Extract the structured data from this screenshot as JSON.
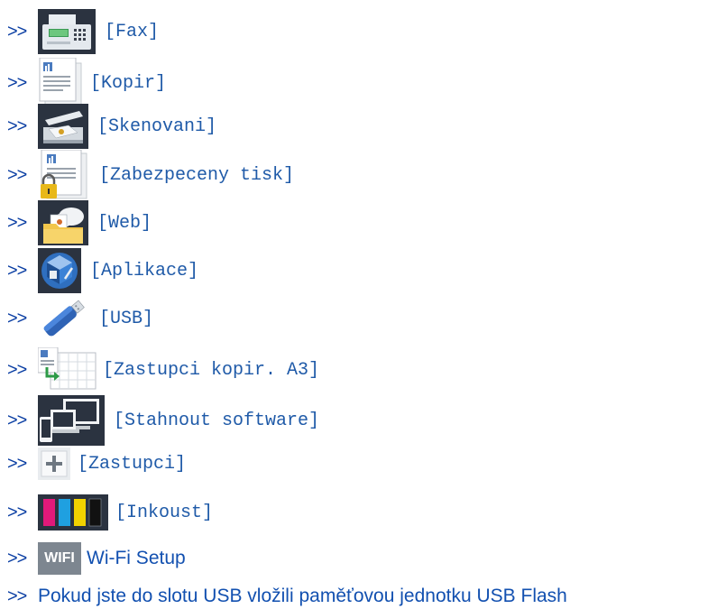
{
  "links": [
    {
      "arrow": ">>",
      "label": "[Fax]",
      "icon": "fax-icon"
    },
    {
      "arrow": ">>",
      "label": "[Kopir]",
      "icon": "copy-icon"
    },
    {
      "arrow": ">>",
      "label": "[Skenovani]",
      "icon": "scanner-icon"
    },
    {
      "arrow": ">>",
      "label": "[Zabezpeceny tisk]",
      "icon": "secure-print-icon"
    },
    {
      "arrow": ">>",
      "label": "[Web]",
      "icon": "web-folder-icon"
    },
    {
      "arrow": ">>",
      "label": "[Aplikace]",
      "icon": "apps-icon"
    },
    {
      "arrow": ">>",
      "label": "[USB]",
      "icon": "usb-icon"
    },
    {
      "arrow": ">>",
      "label": "[Zastupci kopir. A3]",
      "icon": "a3-shortcut-icon"
    },
    {
      "arrow": ">>",
      "label": "[Stahnout software]",
      "icon": "download-software-icon"
    },
    {
      "arrow": ">>",
      "label": "[Zastupci]",
      "icon": "plus-icon"
    },
    {
      "arrow": ">>",
      "label": "[Inkoust]",
      "icon": "ink-icon"
    },
    {
      "arrow": ">>",
      "label": "Wi-Fi Setup",
      "icon": "wifi-icon",
      "icon_text": "WIFI"
    },
    {
      "arrow": ">>",
      "label": "Pokud jste do slotu USB vložili paměťovou jednotku USB Flash"
    }
  ]
}
